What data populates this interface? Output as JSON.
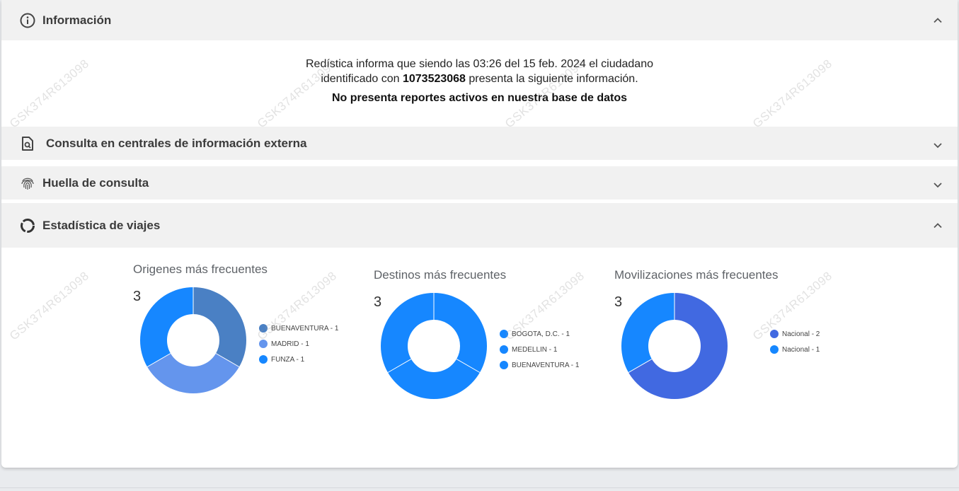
{
  "sections": {
    "informacion": {
      "title": "Información",
      "icon": "info-circle-icon",
      "expanded": true
    },
    "consulta": {
      "title": "Consulta en centrales de información externa",
      "icon": "document-search-icon",
      "expanded": false
    },
    "huella": {
      "title": "Huella de consulta",
      "icon": "fingerprint-icon",
      "expanded": false
    },
    "estadistica": {
      "title": "Estadística de viajes",
      "icon": "donut-chart-icon",
      "expanded": true
    }
  },
  "info": {
    "line1": "Redística informa que siendo las 03:26 del 15 feb. 2024 el ciudadano",
    "line2_prefix": "identificado con ",
    "id_number": "1073523068",
    "line2_suffix": " presenta la siguiente información.",
    "alert": "No presenta reportes activos en nuestra base de datos"
  },
  "watermark": "GSK374R613098",
  "chart_data": [
    {
      "type": "pie",
      "title": "Origenes más frecuentes",
      "total": "3",
      "donut": true,
      "series": [
        {
          "name": "BUENAVENTURA - 1",
          "value": 1,
          "color": "#4a80c4"
        },
        {
          "name": "MADRID - 1",
          "value": 1,
          "color": "#6495ed"
        },
        {
          "name": "FUNZA - 1",
          "value": 1,
          "color": "#1687ff"
        }
      ]
    },
    {
      "type": "pie",
      "title": "Destinos más frecuentes",
      "total": "3",
      "donut": true,
      "series": [
        {
          "name": "BOGOTA, D.C. - 1",
          "value": 1,
          "color": "#1687ff"
        },
        {
          "name": "MEDELLIN - 1",
          "value": 1,
          "color": "#1687ff"
        },
        {
          "name": "BUENAVENTURA - 1",
          "value": 1,
          "color": "#1687ff"
        }
      ]
    },
    {
      "type": "pie",
      "title": "Movilizaciones más frecuentes",
      "total": "3",
      "donut": true,
      "series": [
        {
          "name": "Nacional - 2",
          "value": 2,
          "color": "#4169e1"
        },
        {
          "name": "Nacional - 1",
          "value": 1,
          "color": "#1687ff"
        }
      ]
    }
  ]
}
